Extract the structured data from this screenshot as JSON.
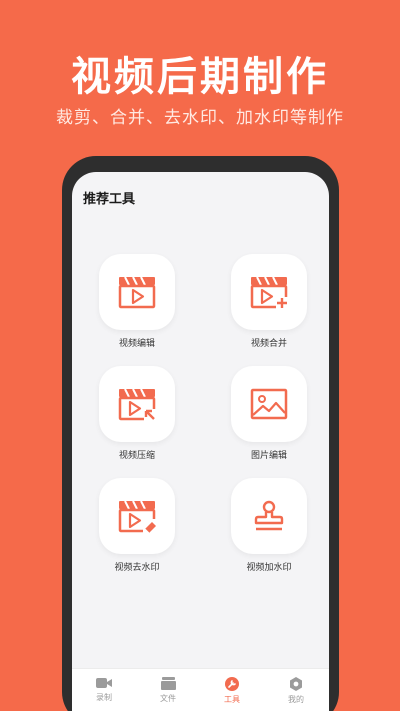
{
  "promo": {
    "title": "视频后期制作",
    "subtitle": "裁剪、合并、去水印、加水印等制作"
  },
  "app": {
    "section_title": "推荐工具",
    "tools": [
      {
        "label": "视频编辑",
        "icon": "video-edit-icon"
      },
      {
        "label": "视频合并",
        "icon": "video-merge-icon"
      },
      {
        "label": "视频压缩",
        "icon": "video-compress-icon"
      },
      {
        "label": "图片编辑",
        "icon": "image-edit-icon"
      },
      {
        "label": "视频去水印",
        "icon": "video-remove-watermark-icon"
      },
      {
        "label": "视频加水印",
        "icon": "stamp-icon"
      }
    ],
    "tabs": [
      {
        "label": "录制",
        "icon": "camera-icon",
        "active": false
      },
      {
        "label": "文件",
        "icon": "folder-icon",
        "active": false
      },
      {
        "label": "工具",
        "icon": "wrench-icon",
        "active": true
      },
      {
        "label": "我的",
        "icon": "settings-hex-icon",
        "active": false
      }
    ]
  },
  "colors": {
    "background": "#f56a4a",
    "accent": "#f26b4f",
    "phone_frame": "#2e2e2e",
    "screen_bg": "#f4f4f6",
    "tab_inactive": "#9b9b9b"
  }
}
